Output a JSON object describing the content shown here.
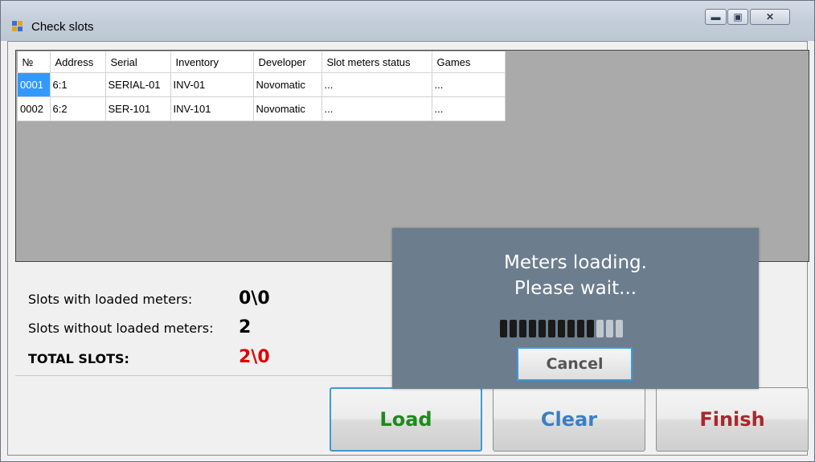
{
  "window": {
    "title": "Check slots",
    "controls": [
      "minimize",
      "maximize",
      "close"
    ]
  },
  "grid": {
    "columns": [
      "№",
      "Address",
      "Serial",
      "Inventory",
      "Developer",
      "Slot meters status",
      "Games"
    ],
    "rows": [
      {
        "no": "0001",
        "address": "6:1",
        "serial": "SERIAL-01",
        "inventory": "INV-01",
        "developer": "Novomatic",
        "status": "...",
        "games": "...",
        "selected": true
      },
      {
        "no": "0002",
        "address": "6:2",
        "serial": "SER-101",
        "inventory": "INV-101",
        "developer": "Novomatic",
        "status": "...",
        "games": "...",
        "selected": false
      }
    ]
  },
  "stats": {
    "loaded_label": "Slots with loaded meters:",
    "loaded_value": "0\\0",
    "not_loaded_label": "Slots without loaded meters:",
    "not_loaded_value": "2",
    "total_label": "TOTAL SLOTS:",
    "total_value": "2\\0",
    "total_color": "#e00000"
  },
  "buttons": {
    "load": {
      "label": "Load",
      "color": "#1d8a1d"
    },
    "clear": {
      "label": "Clear",
      "color": "#3a7fc4"
    },
    "finish": {
      "label": "Finish",
      "color": "#a8282d"
    }
  },
  "overlay": {
    "line1": "Meters loading.",
    "line2": "Please wait...",
    "progress": {
      "filled": 10,
      "total": 13
    },
    "cancel_label": "Cancel"
  }
}
